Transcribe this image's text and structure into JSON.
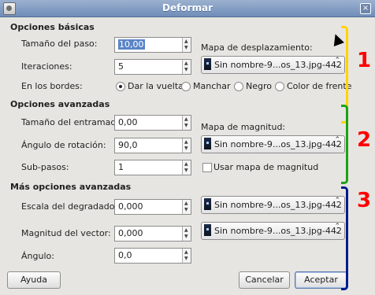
{
  "window": {
    "title": "Deformar"
  },
  "sections": {
    "basic": "Opciones básicas",
    "advanced": "Opciones avanzadas",
    "more": "Más opciones avanzadas"
  },
  "basic": {
    "step_label": "Tamaño del paso:",
    "step_value": "10,00",
    "iter_label": "Iteraciones:",
    "iter_value": "5",
    "edges_label": "En los bordes:",
    "radio": [
      "Dar la vuelta",
      "Manchar",
      "Negro",
      "Color de frente"
    ],
    "radio_selected": "Dar la vuelta",
    "displacement_label": "Mapa de desplazamiento:",
    "displacement_value": "Sin nombre-9...os_13.jpg-442"
  },
  "advanced": {
    "mesh_label": "Tamaño del entramado:",
    "mesh_value": "0,00",
    "rotation_label": "Ángulo de rotación:",
    "rotation_value": "90,0",
    "substeps_label": "Sub-pasos:",
    "substeps_value": "1",
    "magnitude_label": "Mapa de magnitud:",
    "magnitude_value": "Sin nombre-9...os_13.jpg-442",
    "use_magnitude_label": "Usar mapa de magnitud",
    "use_magnitude_checked": false
  },
  "more": {
    "gradient_label": "Escala del degradado:",
    "gradient_value": "0,000",
    "vector_label": "Magnitud del vector:",
    "vector_value": "0,000",
    "angle_label": "Ángulo:",
    "angle_value": "0,0",
    "gradient_map": "Sin nombre-9...os_13.jpg-442",
    "vector_map": "Sin nombre-9...os_13.jpg-442"
  },
  "buttons": {
    "help": "Ayuda",
    "cancel": "Cancelar",
    "ok": "Aceptar"
  },
  "annotations": {
    "n1": "1",
    "n2": "2",
    "n3": "3",
    "colors": {
      "one": "#ffd400",
      "two": "#1aa313",
      "three": "#001a8c",
      "numbers": "#ff0000"
    }
  }
}
